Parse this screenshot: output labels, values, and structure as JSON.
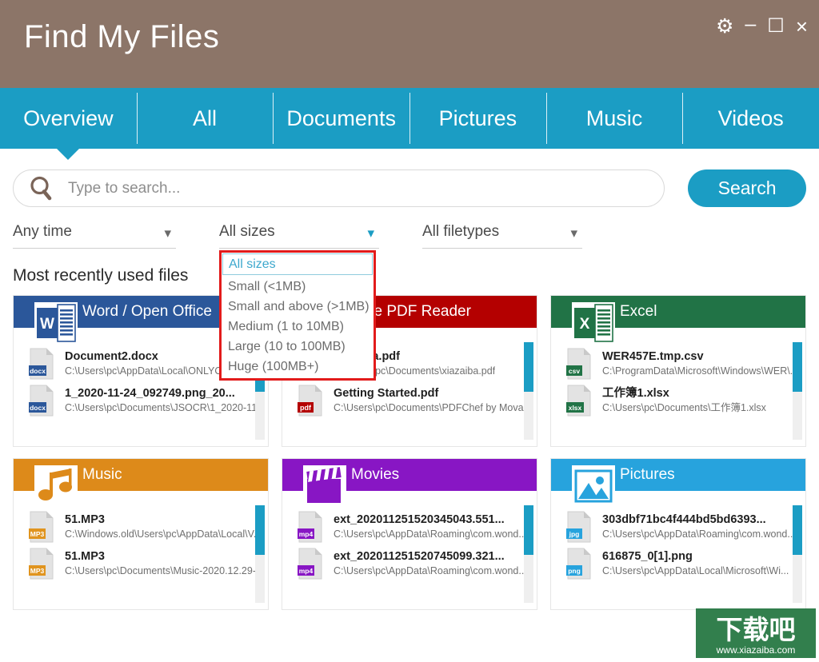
{
  "window": {
    "title": "Find My Files",
    "controls": [
      {
        "name": "settings",
        "glyph": "⚙"
      },
      {
        "name": "minimize",
        "glyph": "–"
      },
      {
        "name": "maximize",
        "glyph": "☐"
      },
      {
        "name": "close",
        "glyph": "×"
      }
    ]
  },
  "colors": {
    "titlebar": "#8c7568",
    "accent": "#1b9dc4",
    "dropdown_border": "#e21b1b",
    "word": "#2b579a",
    "pdf": "#b40000",
    "excel": "#217346",
    "music": "#dd8a1a",
    "movies": "#8816c4",
    "pictures": "#27a3dd"
  },
  "tabs": [
    {
      "label": "Overview",
      "active": true
    },
    {
      "label": "All",
      "active": false
    },
    {
      "label": "Documents",
      "active": false
    },
    {
      "label": "Pictures",
      "active": false
    },
    {
      "label": "Music",
      "active": false
    },
    {
      "label": "Videos",
      "active": false
    }
  ],
  "search": {
    "placeholder": "Type to search...",
    "value": "",
    "button_label": "Search",
    "icon": "search-icon"
  },
  "filters": [
    {
      "id": "time",
      "label": "Any time",
      "open": false
    },
    {
      "id": "size",
      "label": "All sizes",
      "open": true
    },
    {
      "id": "type",
      "label": "All filetypes",
      "open": false
    }
  ],
  "size_dropdown": {
    "open": true,
    "selected": "All sizes",
    "options": [
      "All sizes",
      "Small (<1MB)",
      "Small and above (>1MB)",
      "Medium (1 to 10MB)",
      "Large (10 to 100MB)",
      "Huge (100MB+)"
    ]
  },
  "section": {
    "title": "Most recently used files"
  },
  "cards": [
    {
      "title": "Word / Open Office",
      "color": "#2b579a",
      "icon": "word-icon",
      "files": [
        {
          "name": "Document2.docx",
          "path": "C:\\Users\\pc\\AppData\\Local\\ONLYOFFICE\\...",
          "ext": "docx"
        },
        {
          "name": "1_2020-11-24_092749.png_20...",
          "path": "C:\\Users\\pc\\Documents\\JSOCR\\1_2020-11-...",
          "ext": "docx"
        }
      ]
    },
    {
      "title": "Free PDF Reader",
      "color": "#b40000",
      "icon": "pdf-icon",
      "files": [
        {
          "name": "xiazaiba.pdf",
          "path": "C:\\Users\\pc\\Documents\\xiazaiba.pdf",
          "ext": "pdf"
        },
        {
          "name": "Getting Started.pdf",
          "path": "C:\\Users\\pc\\Documents\\PDFChef by Mova...",
          "ext": "pdf"
        }
      ]
    },
    {
      "title": "Excel",
      "color": "#217346",
      "icon": "excel-icon",
      "files": [
        {
          "name": "WER457E.tmp.csv",
          "path": "C:\\ProgramData\\Microsoft\\Windows\\WER\\...",
          "ext": "csv"
        },
        {
          "name": "工作簿1.xlsx",
          "path": "C:\\Users\\pc\\Documents\\工作簿1.xlsx",
          "ext": "xlsx"
        }
      ]
    },
    {
      "title": "Music",
      "color": "#dd8a1a",
      "icon": "music-note-icon",
      "files": [
        {
          "name": "51.MP3",
          "path": "C:\\Windows.old\\Users\\pc\\AppData\\Local\\V...",
          "ext": "MP3"
        },
        {
          "name": "51.MP3",
          "path": "C:\\Users\\pc\\Documents\\Music-2020.12.29-...",
          "ext": "MP3"
        }
      ]
    },
    {
      "title": "Movies",
      "color": "#8816c4",
      "icon": "clapperboard-icon",
      "files": [
        {
          "name": "ext_202011251520345043.551...",
          "path": "C:\\Users\\pc\\AppData\\Roaming\\com.wond...",
          "ext": "mp4"
        },
        {
          "name": "ext_202011251520745099.321...",
          "path": "C:\\Users\\pc\\AppData\\Roaming\\com.wond...",
          "ext": "mp4"
        }
      ]
    },
    {
      "title": "Pictures",
      "color": "#27a3dd",
      "icon": "photo-icon",
      "files": [
        {
          "name": "303dbf71bc4f444bd5bd6393...",
          "path": "C:\\Users\\pc\\AppData\\Roaming\\com.wond...",
          "ext": "jpg"
        },
        {
          "name": "616875_0[1].png",
          "path": "C:\\Users\\pc\\AppData\\Local\\Microsoft\\Wi...",
          "ext": "png"
        }
      ]
    }
  ],
  "watermark": {
    "text": "下载吧",
    "url": "www.xiazaiba.com"
  }
}
